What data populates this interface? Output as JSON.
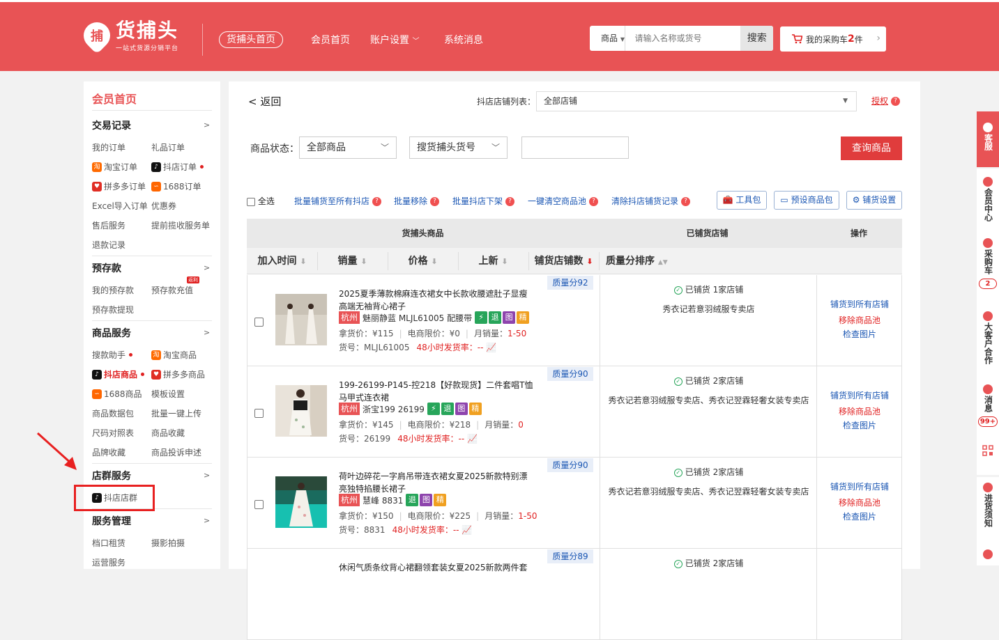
{
  "header": {
    "logo_glyph": "捕",
    "logo_title": "货捕头",
    "logo_subtitle": "一站式货源分销平台",
    "nav_home_pill": "货捕头首页",
    "nav_items": [
      "会员首页",
      "账户设置",
      "系统消息"
    ],
    "search": {
      "category": "商品",
      "placeholder": "请输入名称或货号",
      "button": "搜索"
    },
    "cart": {
      "label": "我的采购车",
      "count": "2",
      "unit": "件"
    }
  },
  "sidebar": {
    "title": "会员首页",
    "sections": {
      "trade": "交易记录",
      "prestore": "预存款",
      "goods": "商品服务",
      "shopgroup": "店群服务",
      "manage": "服务管理"
    },
    "arrow": ">",
    "items": {
      "my_orders": "我的订单",
      "gift_orders": "礼品订单",
      "taobao_orders": "淘宝订单",
      "douyin_orders": "抖店订单",
      "pdd_orders": "拼多多订单",
      "orders_1688": "1688订单",
      "excel_import": "Excel导入订单",
      "coupons": "优惠券",
      "aftersale": "售后服务",
      "advance_collect": "提前揽收服务单",
      "refund_records": "退款记录",
      "my_prestore": "我的预存款",
      "prestore_recharge": "预存款充值",
      "prestore_withdraw": "预存款提现",
      "rebate_badge": "返利",
      "search_helper": "搜款助手",
      "taobao_goods": "淘宝商品",
      "douyin_goods": "抖店商品",
      "pdd_goods": "拼多多商品",
      "goods_1688": "1688商品",
      "template_settings": "模板设置",
      "data_pack": "商品数据包",
      "batch_upload": "批量一键上传",
      "size_chart": "尺码对照表",
      "goods_fav": "商品收藏",
      "brand_fav": "品牌收藏",
      "goods_complaint": "商品投诉申述",
      "douyin_shopgroup": "抖店店群",
      "stall_rent": "档口租赁",
      "photo_shoot": "摄影拍摄",
      "operation": "运营服务"
    }
  },
  "main": {
    "back": "< 返回",
    "shop_list_label": "抖店店铺列表：",
    "shop_list_value": "全部店铺",
    "auth": "授权",
    "status_label": "商品状态：",
    "status_value": "全部商品",
    "search_type": "搜货捕头货号",
    "query_button": "查询商品",
    "select_all": "全选",
    "bulk_actions": [
      "批量铺货至所有抖店",
      "批量移除",
      "批量抖店下架",
      "一键清空商品池",
      "清除抖店铺货记录"
    ],
    "tool_buttons": [
      "工具包",
      "预设商品包",
      "铺货设置"
    ],
    "table": {
      "group_headers": [
        "货捕头商品",
        "已铺货店铺",
        "操作"
      ],
      "columns": [
        "加入时间",
        "销量",
        "价格",
        "上新",
        "铺货店铺数",
        "质量分排序"
      ],
      "row_labels": {
        "take_price": "拿货价：",
        "ecom_limit": "电商限价：",
        "monthly_sales": "月销量：",
        "sku": "货号：",
        "ship_rate": "48小时发货率：",
        "ship_rate_value": "--"
      },
      "actions": [
        "铺货到所有店铺",
        "移除商品池",
        "检查图片"
      ],
      "rows": [
        {
          "title": "2025夏季薄款棉麻连衣裙女中长款收腰遮肚子显瘦高端无袖背心裙子",
          "city": "杭州",
          "vendor": "魅丽静蓝 MLJL61005 配腰带",
          "tags": [
            "⚡",
            "退",
            "图",
            "精"
          ],
          "take_price": "¥115",
          "ecom_limit": "¥0",
          "monthly_sales": "1-50",
          "sku": "MLJL61005",
          "quality": "质量分92",
          "status": "已铺货 1家店铺",
          "shops": "秀衣记若意羽绒服专卖店"
        },
        {
          "title": "199-26199-P145-控218【好款现货】二件套唱T恤马甲式连衣裙",
          "city": "杭州",
          "vendor": "浙宝199 26199",
          "tags": [
            "⚡",
            "退",
            "图",
            "精"
          ],
          "take_price": "¥145",
          "ecom_limit": "¥218",
          "monthly_sales": "0",
          "sku": "26199",
          "quality": "质量分90",
          "status": "已铺货 2家店铺",
          "shops": "秀衣记若意羽绒服专卖店、秀衣记翌霖轻奢女装专卖店"
        },
        {
          "title": "荷叶边碎花一字肩吊带连衣裙女夏2025新款特别漂亮独特掐腰长裙子",
          "city": "杭州",
          "vendor": "慧峰 8831",
          "tags": [
            "退",
            "图",
            "精"
          ],
          "take_price": "¥150",
          "ecom_limit": "¥225",
          "monthly_sales": "1-50",
          "sku": "8831",
          "quality": "质量分90",
          "status": "已铺货 2家店铺",
          "shops": "秀衣记若意羽绒服专卖店、秀衣记翌霖轻奢女装专卖店"
        },
        {
          "title": "休闲气质条纹背心裙翻领套装女夏2025新款两件套",
          "quality": "质量分89",
          "status": "已铺货 2家店铺"
        }
      ]
    }
  },
  "right_panel": {
    "items": [
      "客服",
      "会员中心",
      "采购车",
      "大客户合作",
      "消息",
      "进货须知"
    ],
    "cart_badge": "2",
    "msg_badge": "99+"
  },
  "colors": {
    "brand": "#e85355",
    "link": "#1a56b3",
    "alert": "#e02020"
  }
}
